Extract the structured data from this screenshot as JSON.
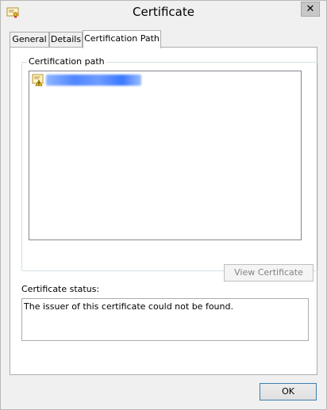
{
  "window": {
    "title": "Certificate",
    "close_glyph": "✕"
  },
  "tabs": [
    {
      "label": "General"
    },
    {
      "label": "Details"
    },
    {
      "label": "Certification Path",
      "active": true
    }
  ],
  "certification_path": {
    "group_label": "Certification path",
    "view_button_label": "View Certificate"
  },
  "status": {
    "label": "Certificate status:",
    "text": "The issuer of this certificate could not be found."
  },
  "ok_label": "OK",
  "icons": {
    "title": "certificate-icon",
    "tree_item": "certificate-warning-icon"
  },
  "colors": {
    "accent_border": "#3c7fb1",
    "disabled_text": "#838383",
    "window_bg": "#f0f0f0"
  }
}
